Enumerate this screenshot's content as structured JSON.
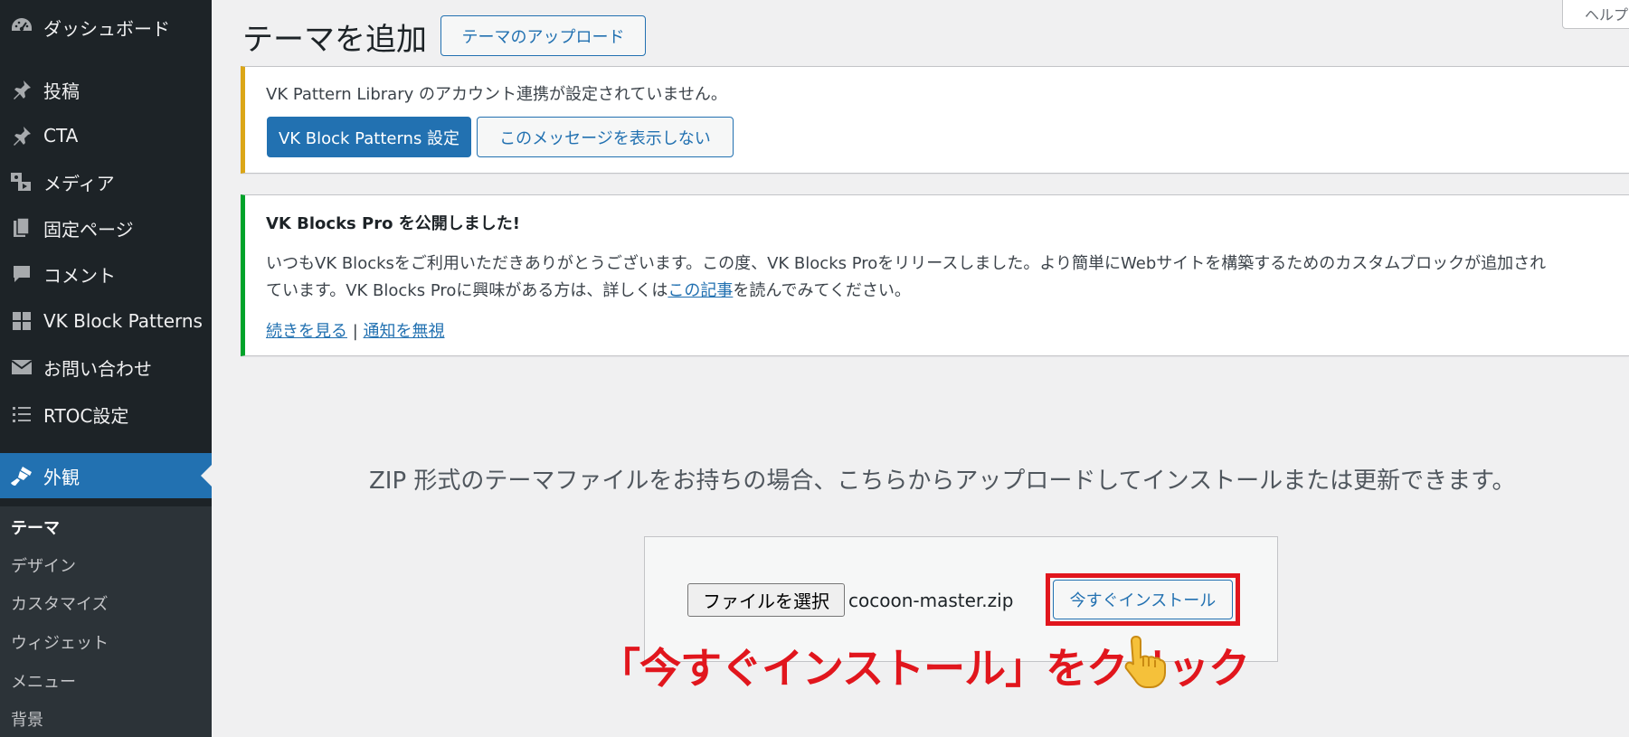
{
  "sidebar": {
    "items": [
      {
        "label": "ダッシュボード",
        "icon": "dashboard-icon"
      },
      {
        "label": "投稿",
        "icon": "pin-icon"
      },
      {
        "label": "CTA",
        "icon": "pin-icon"
      },
      {
        "label": "メディア",
        "icon": "media-icon"
      },
      {
        "label": "固定ページ",
        "icon": "pages-icon"
      },
      {
        "label": "コメント",
        "icon": "comment-icon"
      },
      {
        "label": "VK Block Patterns",
        "icon": "grid-icon"
      },
      {
        "label": "お問い合わせ",
        "icon": "mail-icon"
      },
      {
        "label": "RTOC設定",
        "icon": "list-icon"
      },
      {
        "label": "外観",
        "icon": "brush-icon"
      }
    ],
    "submenu": [
      "テーマ",
      "デザイン",
      "カスタマイズ",
      "ウィジェット",
      "メニュー",
      "背景"
    ]
  },
  "header": {
    "title": "テーマを追加",
    "upload_button": "テーマのアップロード",
    "help_tab": "ヘルプ"
  },
  "notice_warning": {
    "message": "VK Pattern Library のアカウント連携が設定されていません。",
    "primary_button": "VK Block Patterns 設定",
    "secondary_button": "このメッセージを表示しない"
  },
  "notice_success": {
    "title": "VK Blocks Pro を公開しました!",
    "line1": "いつもVK Blocksをご利用いただきありがとうございます。この度、VK Blocks Proをリリースしました。より簡単にWebサイトを構築するためのカスタムブロックが追加され",
    "line2_prefix": "ています。VK Blocks Proに興味がある方は、詳しくは",
    "line2_link": "この記事",
    "line2_suffix": "を読んでみてください。",
    "link_more": "続きを見る",
    "separator": "|",
    "link_dismiss": "通知を無視"
  },
  "upload": {
    "help_text": "ZIP 形式のテーマファイルをお持ちの場合、こちらからアップロードしてインストールまたは更新できます。",
    "file_button": "ファイルを選択",
    "file_name": "cocoon-master.zip",
    "install_button": "今すぐインストール"
  },
  "annotation": {
    "callout": "「今すぐインストール」をクリック",
    "highlight_color": "#e1161d"
  }
}
